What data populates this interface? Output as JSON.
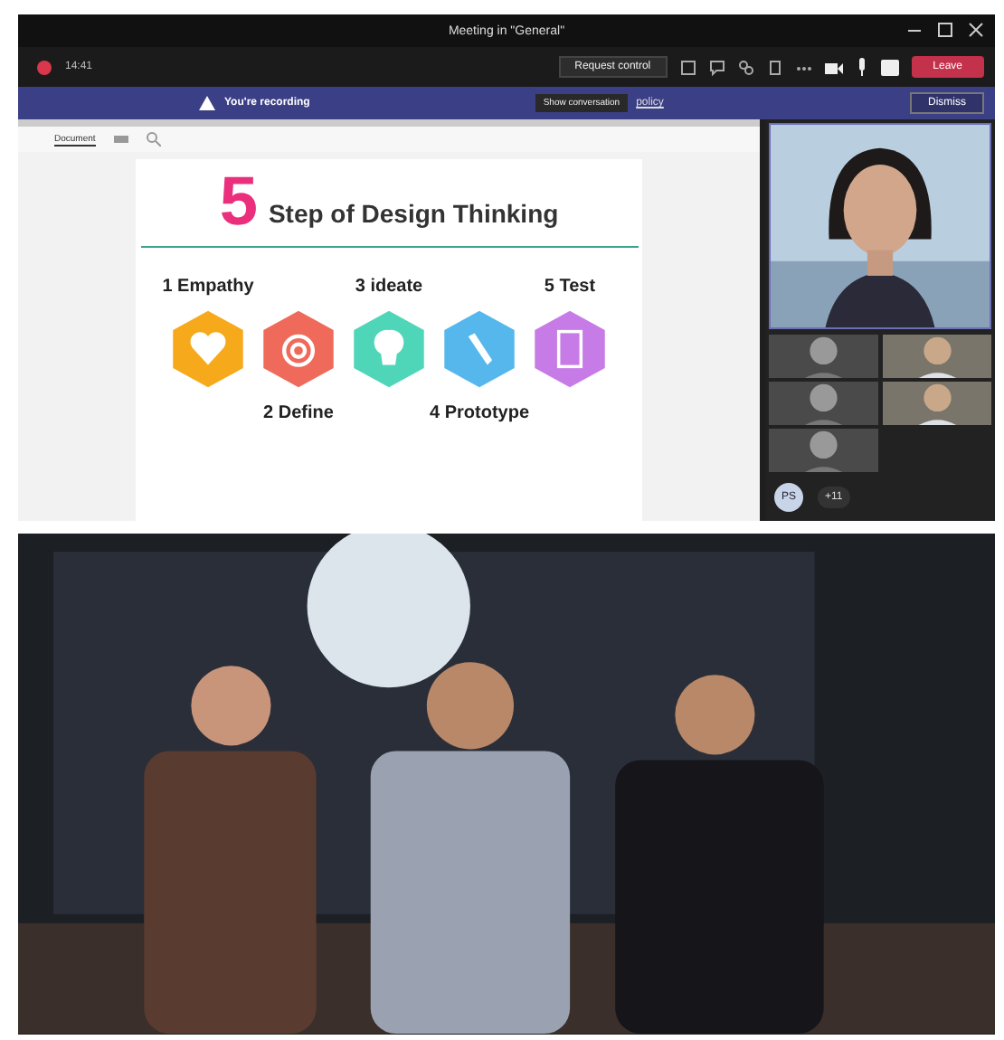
{
  "window": {
    "title": "Meeting in \"General\""
  },
  "toolbar": {
    "time": "14:41",
    "request_control": "Request control",
    "leave": "Leave"
  },
  "banner": {
    "label": "You're recording",
    "link": "policy",
    "tooltip": "Show conversation",
    "dismiss": "Dismiss"
  },
  "document": {
    "tabs": [
      {
        "label": "Document",
        "selected": true
      }
    ]
  },
  "slide": {
    "number": "5",
    "title": "Step of Design Thinking",
    "steps": [
      {
        "label": "1 Empathy",
        "kind": "above",
        "color": "#f6a91b"
      },
      {
        "label": "2 Define",
        "kind": "below",
        "color": "#ef6a5a"
      },
      {
        "label": "3 ideate",
        "kind": "above",
        "color": "#4fd6b8"
      },
      {
        "label": "4 Prototype",
        "kind": "below",
        "color": "#55b7ec"
      },
      {
        "label": "5 Test",
        "kind": "above",
        "color": "#c77be6"
      }
    ]
  },
  "participants": {
    "avatar": "PS",
    "overflow": "+11"
  }
}
